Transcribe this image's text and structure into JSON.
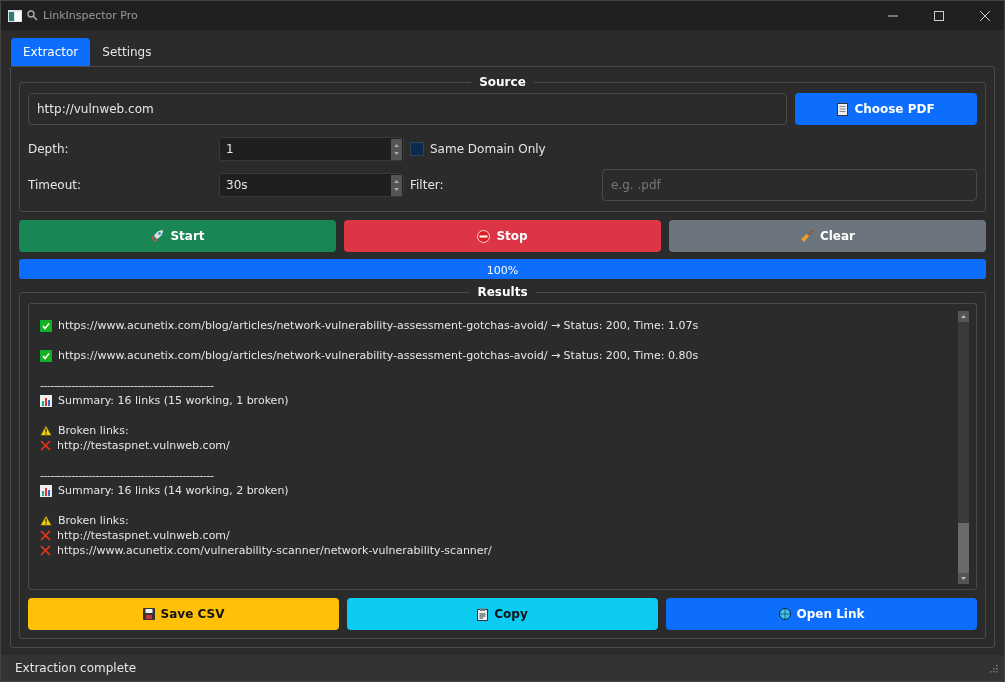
{
  "window": {
    "title": "LinkInspector Pro"
  },
  "tabs": [
    {
      "label": "Extractor",
      "selected": true
    },
    {
      "label": "Settings",
      "selected": false
    }
  ],
  "source": {
    "title": "Source",
    "url": {
      "value": "http://vulnweb.com"
    },
    "choose_button": "Choose PDF",
    "depth": {
      "label": "Depth:",
      "value": "1"
    },
    "same_domain": {
      "label": "Same Domain Only",
      "checked": false
    },
    "timeout": {
      "label": "Timeout:",
      "value": "30s"
    },
    "filter": {
      "label": "Filter:",
      "placeholder": "e.g. .pdf"
    }
  },
  "actions": [
    {
      "kind": "start",
      "label": "Start"
    },
    {
      "kind": "stop",
      "label": "Stop"
    },
    {
      "kind": "clear",
      "label": "Clear"
    }
  ],
  "progress": {
    "level": 1,
    "text": "100%"
  },
  "results": {
    "title": "Results",
    "blocks": [
      {
        "lines": [
          {
            "kind": "ok",
            "text": "https://www.acunetix.com/blog/articles/network-vulnerability-assessment-gotchas-avoid/ → Status: 200, Time: 1.07s"
          }
        ]
      },
      {
        "lines": [
          {
            "kind": "ok",
            "text": "https://www.acunetix.com/blog/articles/network-vulnerability-assessment-gotchas-avoid/ → Status: 200, Time: 0.80s"
          }
        ]
      },
      {
        "lines": [
          {
            "kind": "rule",
            "text": "--------------------------------------------------"
          },
          {
            "kind": "summary",
            "text": "Summary: 16 links (15 working, 1 broken)"
          }
        ]
      },
      {
        "lines": [
          {
            "kind": "warning",
            "text": "Broken links:"
          },
          {
            "kind": "error",
            "text": "http://testaspnet.vulnweb.com/"
          }
        ]
      },
      {
        "lines": [
          {
            "kind": "rule",
            "text": "--------------------------------------------------"
          },
          {
            "kind": "summary",
            "text": "Summary: 16 links (14 working, 2 broken)"
          }
        ]
      },
      {
        "lines": [
          {
            "kind": "warning",
            "text": "Broken links:"
          },
          {
            "kind": "error",
            "text": "http://testaspnet.vulnweb.com/"
          },
          {
            "kind": "error",
            "text": "https://www.acunetix.com/vulnerability-scanner/network-vulnerability-scanner/"
          }
        ]
      }
    ]
  },
  "bottom_actions": [
    {
      "kind": "save",
      "label": "Save CSV"
    },
    {
      "kind": "copy",
      "label": "Copy"
    },
    {
      "kind": "open",
      "label": "Open Link"
    }
  ],
  "status_bar": "Extraction complete"
}
